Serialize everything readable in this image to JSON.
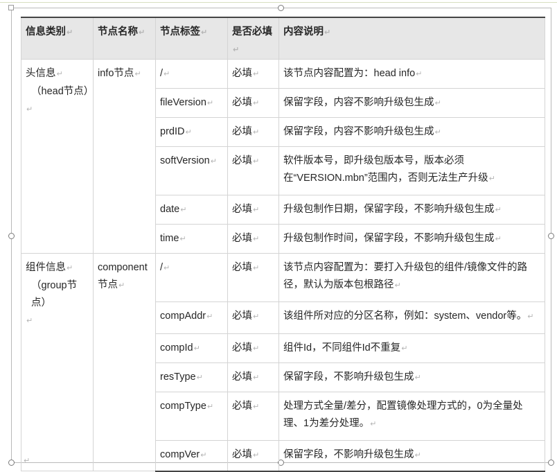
{
  "headers": [
    "信息类别",
    "节点名称",
    "节点标签",
    "是否必填",
    "内容说明"
  ],
  "groups": [
    {
      "category_line1": "头信息",
      "category_line2": "（head节点）",
      "node_name_line1": "info节点",
      "node_name_line2": "",
      "rows": [
        {
          "tag": "/",
          "required": "必填",
          "desc": "该节点内容配置为：head info"
        },
        {
          "tag": "fileVersion",
          "required": "必填",
          "desc": "保留字段，内容不影响升级包生成"
        },
        {
          "tag": "prdID",
          "required": "必填",
          "desc": "保留字段，内容不影响升级包生成"
        },
        {
          "tag": "softVersion",
          "required": "必填",
          "desc": "软件版本号，即升级包版本号，版本必须在“VERSION.mbn”范围内，否则无法生产升级"
        },
        {
          "tag": "date",
          "required": "必填",
          "desc": "升级包制作日期，保留字段，不影响升级包生成"
        },
        {
          "tag": "time",
          "required": "必填",
          "desc": "升级包制作时间，保留字段，不影响升级包生成"
        }
      ]
    },
    {
      "category_line1": "组件信息",
      "category_line2": "（group节点）",
      "node_name_line1": "component",
      "node_name_line2": "节点",
      "rows": [
        {
          "tag": "/",
          "required": "必填",
          "desc": "该节点内容配置为：要打入升级包的组件/镜像文件的路径，默认为版本包根路径"
        },
        {
          "tag": "compAddr",
          "required": "必填",
          "desc": "该组件所对应的分区名称，例如：system、vendor等。"
        },
        {
          "tag": "compId",
          "required": "必填",
          "desc": "组件Id，不同组件Id不重复"
        },
        {
          "tag": "resType",
          "required": "必填",
          "desc": "保留字段，不影响升级包生成"
        },
        {
          "tag": "compType",
          "required": "必填",
          "desc": "处理方式全量/差分，配置镜像处理方式的，0为全量处理、1为差分处理。"
        },
        {
          "tag": "compVer",
          "required": "必填",
          "desc": "保留字段，不影响升级包生成"
        }
      ]
    }
  ],
  "paragraph_mark": "↵"
}
